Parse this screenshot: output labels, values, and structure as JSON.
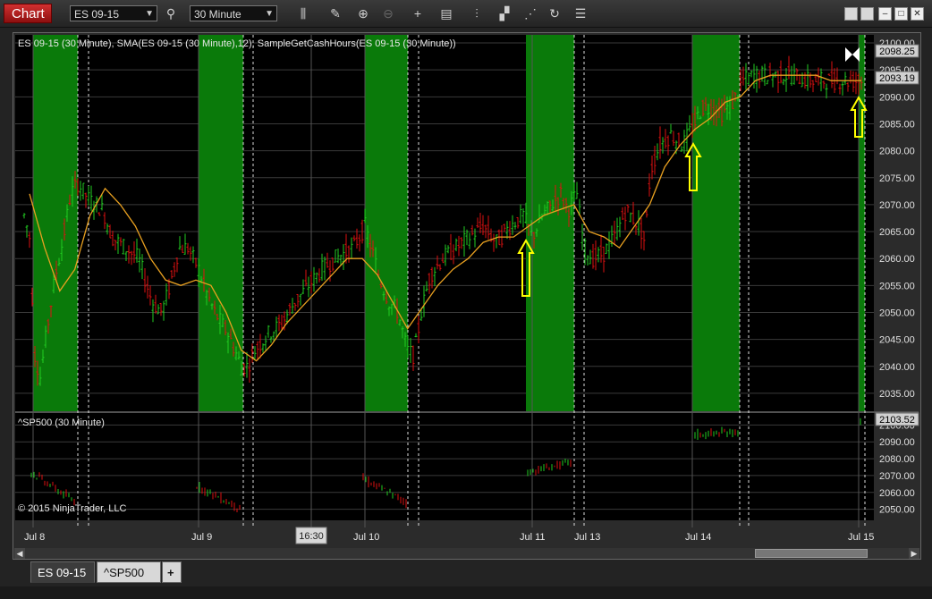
{
  "toolbar": {
    "chart_label": "Chart",
    "instrument": "ES 09-15",
    "interval": "30 Minute",
    "tools": [
      "bar-type-icon",
      "pencil-icon",
      "zoom-in-icon",
      "zoom-out-icon",
      "crosshair-icon",
      "data-box-icon",
      "indicators-icon",
      "strategies-icon",
      "drawing-tools-icon",
      "reload-icon",
      "properties-icon"
    ]
  },
  "panel1": {
    "title": "ES 09-15 (30 Minute), SMA(ES 09-15 (30 Minute),12), SampleGetCashHours(ES 09-15 (30 Minute))",
    "price_labels": [
      "2098.25",
      "2093.19"
    ],
    "y_ticks": [
      "2100.00",
      "2095.00",
      "2090.00",
      "2085.00",
      "2080.00",
      "2075.00",
      "2070.00",
      "2065.00",
      "2060.00",
      "2055.00",
      "2050.00",
      "2045.00",
      "2040.00",
      "2035.00"
    ]
  },
  "panel2": {
    "title": "^SP500 (30 Minute)",
    "price_label": "2103.52",
    "copyright": "© 2015 NinjaTrader, LLC",
    "y_ticks": [
      "2100.00",
      "2090.00",
      "2080.00",
      "2070.00",
      "2060.00",
      "2050.00"
    ]
  },
  "x_labels": [
    "Jul 8",
    "Jul 9",
    "16:30",
    "Jul 10",
    "Jul 11",
    "Jul 13",
    "Jul 14",
    "Jul 15"
  ],
  "tabs": [
    "ES 09-15",
    "^SP500"
  ],
  "add_tab": "+",
  "colors": {
    "session_green": "#0a7a0a",
    "up_bar": "#22cc22",
    "down_bar": "#dd1111",
    "sma": "#e8a020",
    "arrow": "#ffff00"
  },
  "chart_data": [
    {
      "type": "line",
      "title": "ES 09-15 (30 Minute), SMA(ES 09-15 (30 Minute),12), SampleGetCashHours(ES 09-15 (30 Minute))",
      "series": [
        {
          "name": "SMA(ES 09-15 (30 Minute),12)",
          "values": [
            2072,
            2062,
            2054,
            2058,
            2068,
            2073,
            2070,
            2066,
            2060,
            2056,
            2055,
            2056,
            2055,
            2050,
            2043,
            2041,
            2044,
            2048,
            2051,
            2054,
            2057,
            2060,
            2060,
            2057,
            2052,
            2047,
            2051,
            2055,
            2058,
            2060,
            2063,
            2064,
            2064,
            2066,
            2068,
            2069,
            2070,
            2065,
            2064,
            2062,
            2066,
            2070,
            2077,
            2081,
            2084,
            2086,
            2089,
            2090,
            2093,
            2094,
            2094,
            2094,
            2094,
            2093,
            2093,
            2093
          ]
        }
      ],
      "ylim": [
        2032,
        2101
      ]
    }
  ]
}
